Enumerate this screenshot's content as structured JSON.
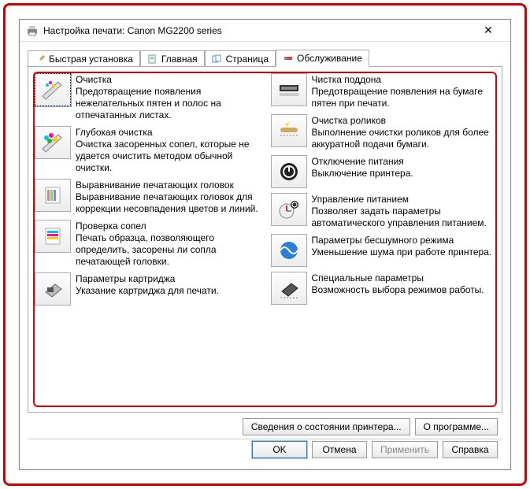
{
  "window": {
    "title": "Настройка печати: Canon MG2200 series",
    "close": "✕"
  },
  "tabs": {
    "quick": "Быстрая установка",
    "main": "Главная",
    "page": "Страница",
    "maint": "Обслуживание"
  },
  "left": [
    {
      "title": "Очистка",
      "desc": "Предотвращение появления нежелательных пятен и полос на отпечатанных листах."
    },
    {
      "title": "Глубокая очистка",
      "desc": "Очистка засоренных сопел, которые не удается очистить методом обычной очистки."
    },
    {
      "title": "Выравнивание печатающих головок",
      "desc": "Выравнивание печатающих головок для коррекции несовпадения цветов и линий."
    },
    {
      "title": "Проверка сопел",
      "desc": "Печать образца, позволяющего определить, засорены ли сопла печатающей головки."
    },
    {
      "title": "Параметры картриджа",
      "desc": "Указание картриджа для печати."
    }
  ],
  "right": [
    {
      "title": "Чистка поддона",
      "desc": "Предотвращение появления на бумаге пятен при печати."
    },
    {
      "title": "Очистка роликов",
      "desc": "Выполнение очистки роликов для более аккуратной подачи бумаги."
    },
    {
      "title": "Отключение питания",
      "desc": "Выключение принтера."
    },
    {
      "title": "Управление питанием",
      "desc": "Позволяет задать параметры автоматического управления питанием."
    },
    {
      "title": "Параметры бесшумного режима",
      "desc": "Уменьшение шума при работе принтера."
    },
    {
      "title": "Специальные параметры",
      "desc": "Возможность выбора режимов работы."
    }
  ],
  "buttons": {
    "status": "Сведения о состоянии принтера...",
    "about": "О программе...",
    "ok": "OK",
    "cancel": "Отмена",
    "apply": "Применить",
    "help": "Справка"
  }
}
